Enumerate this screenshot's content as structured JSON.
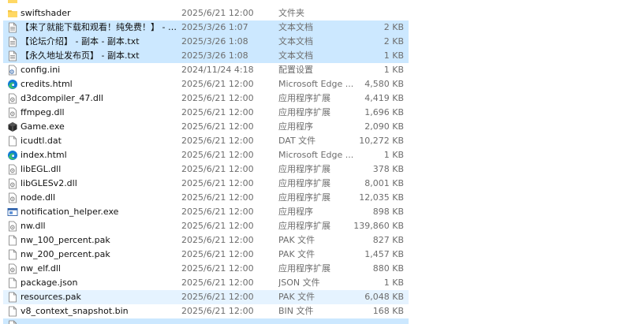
{
  "files": [
    {
      "name": "",
      "date": "",
      "type": "",
      "size": "",
      "icon": "folder-icon",
      "state": "none"
    },
    {
      "name": "swiftshader",
      "date": "2025/6/21 12:00",
      "type": "文件夹",
      "size": "",
      "icon": "folder-icon",
      "state": "none"
    },
    {
      "name": "【来了就能下载和观看！纯免费！】 - 副...",
      "date": "2025/3/26 1:07",
      "type": "文本文档",
      "size": "2 KB",
      "icon": "text-file-icon",
      "state": "selected"
    },
    {
      "name": "【论坛介绍】 - 副本 - 副本.txt",
      "date": "2025/3/26 1:08",
      "type": "文本文档",
      "size": "2 KB",
      "icon": "text-file-icon",
      "state": "selected"
    },
    {
      "name": "【永久地址发布页】 - 副本.txt",
      "date": "2025/3/26 1:08",
      "type": "文本文档",
      "size": "1 KB",
      "icon": "text-file-icon",
      "state": "selected"
    },
    {
      "name": "config.ini",
      "date": "2024/11/24 4:18",
      "type": "配置设置",
      "size": "1 KB",
      "icon": "config-file-icon",
      "state": "none"
    },
    {
      "name": "credits.html",
      "date": "2025/6/21 12:00",
      "type": "Microsoft Edge ...",
      "size": "4,580 KB",
      "icon": "edge-icon",
      "state": "none"
    },
    {
      "name": "d3dcompiler_47.dll",
      "date": "2025/6/21 12:00",
      "type": "应用程序扩展",
      "size": "4,419 KB",
      "icon": "dll-file-icon",
      "state": "none"
    },
    {
      "name": "ffmpeg.dll",
      "date": "2025/6/21 12:00",
      "type": "应用程序扩展",
      "size": "1,696 KB",
      "icon": "dll-file-icon",
      "state": "none"
    },
    {
      "name": "Game.exe",
      "date": "2025/6/21 12:00",
      "type": "应用程序",
      "size": "2,090 KB",
      "icon": "game-exe-icon",
      "state": "none"
    },
    {
      "name": "icudtl.dat",
      "date": "2025/6/21 12:00",
      "type": "DAT 文件",
      "size": "10,272 KB",
      "icon": "blank-file-icon",
      "state": "none"
    },
    {
      "name": "index.html",
      "date": "2025/6/21 12:00",
      "type": "Microsoft Edge ...",
      "size": "1 KB",
      "icon": "edge-icon",
      "state": "none"
    },
    {
      "name": "libEGL.dll",
      "date": "2025/6/21 12:00",
      "type": "应用程序扩展",
      "size": "378 KB",
      "icon": "dll-file-icon",
      "state": "none"
    },
    {
      "name": "libGLESv2.dll",
      "date": "2025/6/21 12:00",
      "type": "应用程序扩展",
      "size": "8,001 KB",
      "icon": "dll-file-icon",
      "state": "none"
    },
    {
      "name": "node.dll",
      "date": "2025/6/21 12:00",
      "type": "应用程序扩展",
      "size": "12,035 KB",
      "icon": "dll-file-icon",
      "state": "none"
    },
    {
      "name": "notification_helper.exe",
      "date": "2025/6/21 12:00",
      "type": "应用程序",
      "size": "898 KB",
      "icon": "exe-window-icon",
      "state": "none"
    },
    {
      "name": "nw.dll",
      "date": "2025/6/21 12:00",
      "type": "应用程序扩展",
      "size": "139,860 KB",
      "icon": "dll-file-icon",
      "state": "none"
    },
    {
      "name": "nw_100_percent.pak",
      "date": "2025/6/21 12:00",
      "type": "PAK 文件",
      "size": "827 KB",
      "icon": "blank-file-icon",
      "state": "none"
    },
    {
      "name": "nw_200_percent.pak",
      "date": "2025/6/21 12:00",
      "type": "PAK 文件",
      "size": "1,457 KB",
      "icon": "blank-file-icon",
      "state": "none"
    },
    {
      "name": "nw_elf.dll",
      "date": "2025/6/21 12:00",
      "type": "应用程序扩展",
      "size": "880 KB",
      "icon": "dll-file-icon",
      "state": "none"
    },
    {
      "name": "package.json",
      "date": "2025/6/21 12:00",
      "type": "JSON 文件",
      "size": "1 KB",
      "icon": "blank-file-icon",
      "state": "none"
    },
    {
      "name": "resources.pak",
      "date": "2025/6/21 12:00",
      "type": "PAK 文件",
      "size": "6,048 KB",
      "icon": "blank-file-icon",
      "state": "hover"
    },
    {
      "name": "v8_context_snapshot.bin",
      "date": "2025/6/21 12:00",
      "type": "BIN 文件",
      "size": "168 KB",
      "icon": "blank-file-icon",
      "state": "none"
    },
    {
      "name": "",
      "date": "",
      "type": "",
      "size": "",
      "icon": "text-file-icon",
      "state": "selected"
    }
  ],
  "colors": {
    "selected_bg": "#cce8ff",
    "hover_bg": "#e5f3ff",
    "folder": "#f4c542",
    "edge_blue": "#0f7bd6",
    "edge_green": "#3bbf6a"
  }
}
